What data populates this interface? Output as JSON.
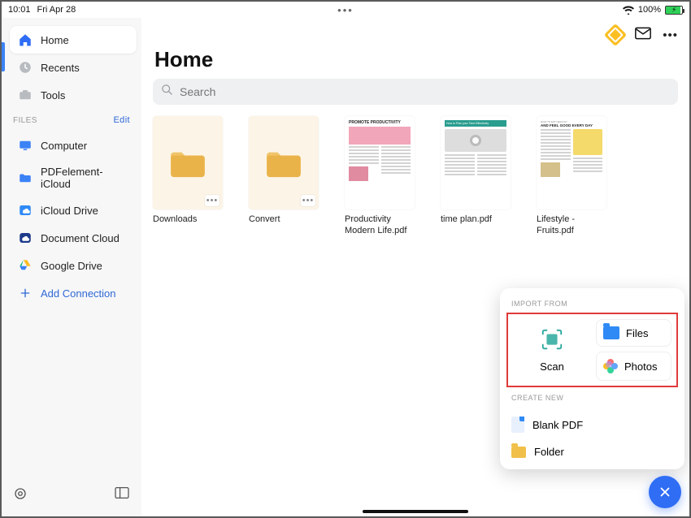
{
  "status": {
    "time": "10:01",
    "date": "Fri Apr 28",
    "battery_pct": "100%"
  },
  "topbar": {
    "more": "•••"
  },
  "sidebar": {
    "nav": [
      {
        "label": "Home",
        "icon": "home"
      },
      {
        "label": "Recents",
        "icon": "clock"
      },
      {
        "label": "Tools",
        "icon": "tools"
      }
    ],
    "section_title": "FILES",
    "edit_label": "Edit",
    "files": [
      {
        "label": "Computer",
        "icon": "computer"
      },
      {
        "label": "PDFelement-iCloud",
        "icon": "cloud-folder"
      },
      {
        "label": "iCloud Drive",
        "icon": "cloud-drive"
      },
      {
        "label": "Document Cloud",
        "icon": "doc-cloud"
      },
      {
        "label": "Google Drive",
        "icon": "gdrive"
      }
    ],
    "add_connection_label": "Add Connection"
  },
  "page": {
    "title": "Home",
    "search_placeholder": "Search"
  },
  "tiles": [
    {
      "label": "Downloads",
      "kind": "folder"
    },
    {
      "label": "Convert",
      "kind": "folder"
    },
    {
      "label": "Productivity Modern Life.pdf",
      "kind": "doc",
      "thumb_title": "PROMOTE PRODUCTIVITY"
    },
    {
      "label": "time plan.pdf",
      "kind": "doc",
      "thumb_title": "How to Plan your Time Effectively"
    },
    {
      "label": "Lifestyle - Fruits.pdf",
      "kind": "doc",
      "thumb_title": "AND FEEL GOOD EVERY DAY"
    }
  ],
  "popup": {
    "import_title": "IMPORT FROM",
    "scan_label": "Scan",
    "files_label": "Files",
    "photos_label": "Photos",
    "create_title": "CREATE NEW",
    "blankpdf_label": "Blank PDF",
    "folder_label": "Folder"
  }
}
